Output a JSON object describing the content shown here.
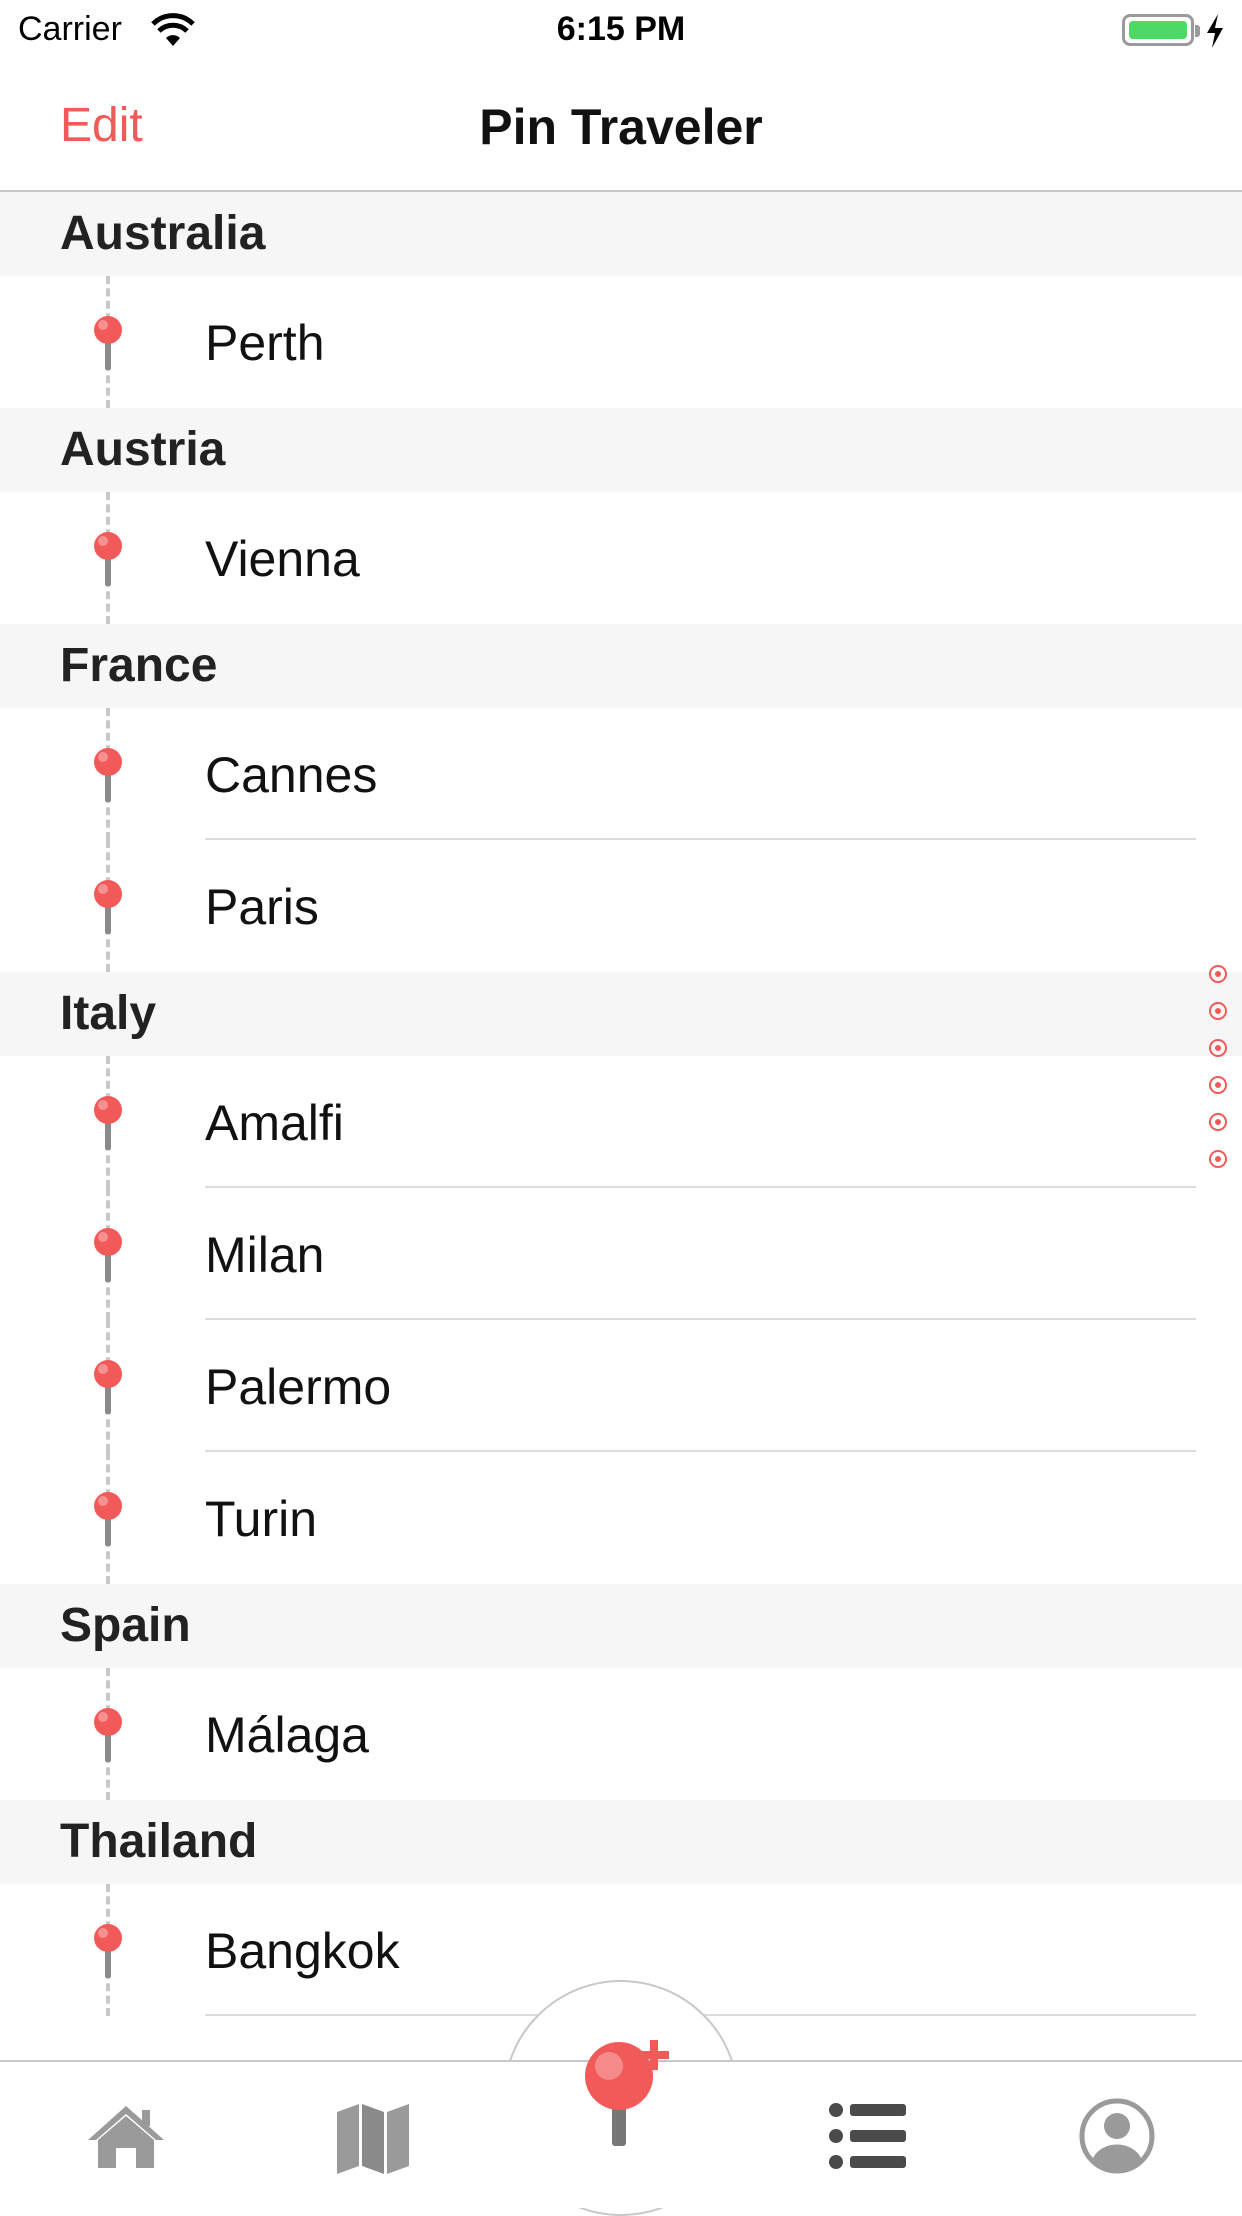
{
  "status_bar": {
    "carrier": "Carrier",
    "time": "6:15 PM",
    "battery_color": "#4cd964"
  },
  "nav": {
    "edit_label": "Edit",
    "title": "Pin Traveler"
  },
  "colors": {
    "accent": "#f25a5a",
    "section_bg": "#f6f6f7",
    "tab_icon": "#9a9a9a"
  },
  "sections": [
    {
      "country": "Australia",
      "cities": [
        "Perth"
      ]
    },
    {
      "country": "Austria",
      "cities": [
        "Vienna"
      ]
    },
    {
      "country": "France",
      "cities": [
        "Cannes",
        "Paris"
      ]
    },
    {
      "country": "Italy",
      "cities": [
        "Amalfi",
        "Milan",
        "Palermo",
        "Turin"
      ]
    },
    {
      "country": "Spain",
      "cities": [
        "Málaga"
      ]
    },
    {
      "country": "Thailand",
      "cities": [
        "Bangkok"
      ]
    }
  ],
  "tab_bar": {
    "items": [
      {
        "icon": "home-icon"
      },
      {
        "icon": "map-icon"
      },
      {
        "icon": "add-pin-icon"
      },
      {
        "icon": "list-icon"
      },
      {
        "icon": "profile-icon"
      }
    ]
  }
}
